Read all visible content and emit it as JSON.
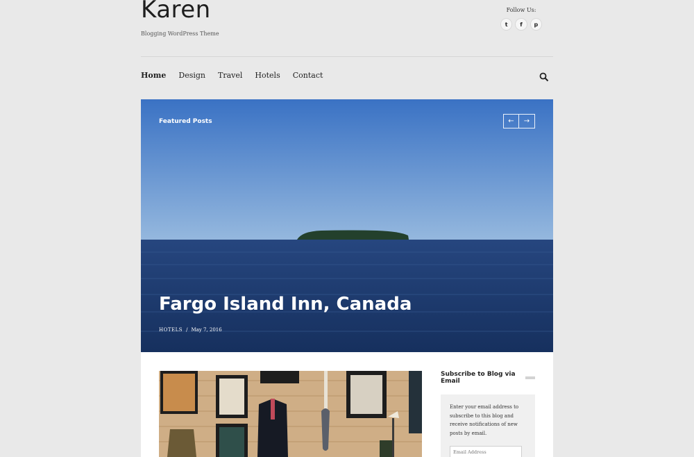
{
  "site": {
    "title": "Karen",
    "tagline": "Blogging WordPress Theme",
    "follow_label": "Follow Us:",
    "social": [
      {
        "icon": "twitter-icon",
        "glyph": "t"
      },
      {
        "icon": "facebook-icon",
        "glyph": "f"
      },
      {
        "icon": "pinterest-icon",
        "glyph": "p"
      }
    ]
  },
  "nav": {
    "items": [
      "Home",
      "Design",
      "Travel",
      "Hotels",
      "Contact"
    ],
    "active": "Home",
    "search_icon": "search-icon"
  },
  "hero": {
    "label": "Featured Posts",
    "prev_glyph": "←",
    "next_glyph": "→",
    "title": "Fargo Island Inn, Canada",
    "category": "Hotels",
    "separator": "/",
    "date": "May 7, 2016"
  },
  "sidebar": {
    "widget_title": "Subscribe to Blog via Email",
    "widget_text": "Enter your email address to subscribe to this blog and receive notifications of new posts by email.",
    "email_placeholder": "Email Address"
  },
  "colors": {
    "background": "#e9e9e9",
    "sky_top": "#3b75c6",
    "sky_bottom": "#8fb3dc",
    "sea": "#1e3b70"
  }
}
